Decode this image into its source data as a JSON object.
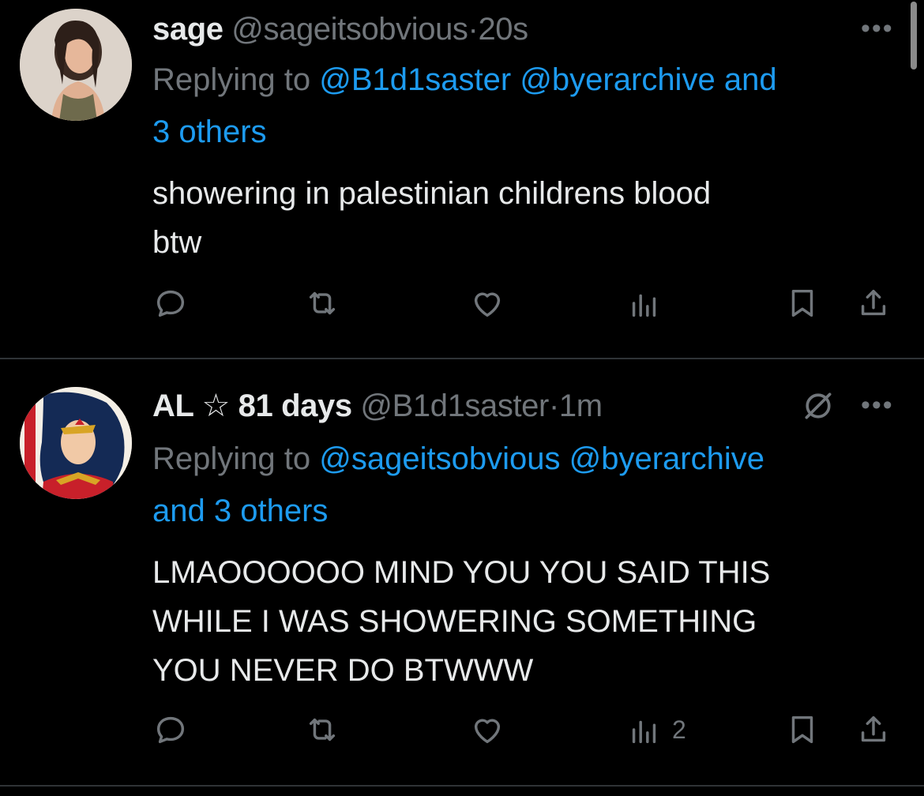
{
  "tweets": [
    {
      "display_name": "sage",
      "handle": "@sageitsobvious",
      "separator": "·",
      "time": "20s",
      "replying_prefix": "Replying to",
      "replying_mentions": [
        "@B1d1saster",
        "@byerarchive"
      ],
      "replying_and": "and",
      "replying_others": "3 others",
      "text_line1": "showering in palestinian childrens blood",
      "text_line2": "btw",
      "views_count": "",
      "more_label": "•••"
    },
    {
      "display_name": "AL ☆ 81 days",
      "handle": "@B1d1saster",
      "separator": "·",
      "time": "1m",
      "replying_prefix": "Replying to",
      "replying_mentions": [
        "@sageitsobvious",
        "@byerarchive"
      ],
      "replying_and": "and",
      "replying_others": "3 others",
      "text_line1": "LMAOOOOOO MIND YOU YOU SAID THIS",
      "text_line2": "WHILE I WAS SHOWERING SOMETHING",
      "text_line3": "YOU NEVER DO BTWWW",
      "views_count": "2",
      "more_label": "•••"
    }
  ],
  "colors": {
    "background": "#000000",
    "text": "#e7e9ea",
    "secondary": "#71767b",
    "accent": "#1d9bf0",
    "divider": "#2f3336"
  },
  "icons": [
    "reply-icon",
    "retweet-icon",
    "like-icon",
    "views-icon",
    "bookmark-icon",
    "share-icon",
    "grok-icon",
    "more-icon"
  ]
}
